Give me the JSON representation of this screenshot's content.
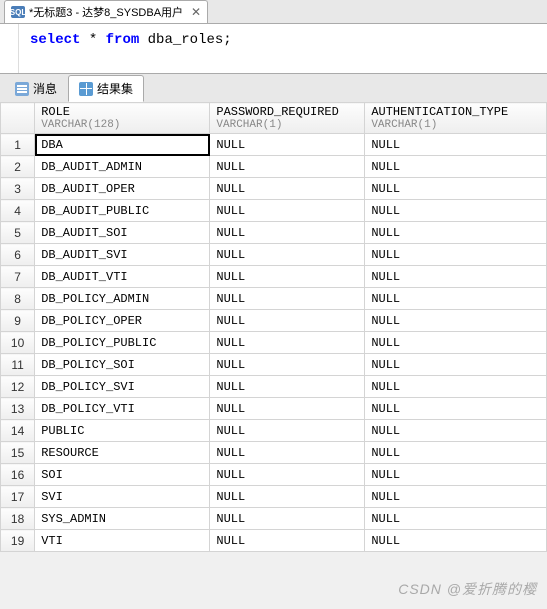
{
  "editor": {
    "tab_icon": "SQL",
    "tab_title": "*无标题3 - 达梦8_SYSDBA用户",
    "sql": {
      "select": "select",
      "star": "*",
      "from": "from",
      "table": "dba_roles",
      "semicolon": ";"
    }
  },
  "result_tabs": {
    "messages": "消息",
    "results": "结果集"
  },
  "grid": {
    "columns": [
      {
        "name": "ROLE",
        "type": "VARCHAR(128)"
      },
      {
        "name": "PASSWORD_REQUIRED",
        "type": "VARCHAR(1)"
      },
      {
        "name": "AUTHENTICATION_TYPE",
        "type": "VARCHAR(1)"
      }
    ],
    "rows": [
      {
        "n": "1",
        "role": "DBA",
        "pwd": "NULL",
        "auth": "NULL"
      },
      {
        "n": "2",
        "role": "DB_AUDIT_ADMIN",
        "pwd": "NULL",
        "auth": "NULL"
      },
      {
        "n": "3",
        "role": "DB_AUDIT_OPER",
        "pwd": "NULL",
        "auth": "NULL"
      },
      {
        "n": "4",
        "role": "DB_AUDIT_PUBLIC",
        "pwd": "NULL",
        "auth": "NULL"
      },
      {
        "n": "5",
        "role": "DB_AUDIT_SOI",
        "pwd": "NULL",
        "auth": "NULL"
      },
      {
        "n": "6",
        "role": "DB_AUDIT_SVI",
        "pwd": "NULL",
        "auth": "NULL"
      },
      {
        "n": "7",
        "role": "DB_AUDIT_VTI",
        "pwd": "NULL",
        "auth": "NULL"
      },
      {
        "n": "8",
        "role": "DB_POLICY_ADMIN",
        "pwd": "NULL",
        "auth": "NULL"
      },
      {
        "n": "9",
        "role": "DB_POLICY_OPER",
        "pwd": "NULL",
        "auth": "NULL"
      },
      {
        "n": "10",
        "role": "DB_POLICY_PUBLIC",
        "pwd": "NULL",
        "auth": "NULL"
      },
      {
        "n": "11",
        "role": "DB_POLICY_SOI",
        "pwd": "NULL",
        "auth": "NULL"
      },
      {
        "n": "12",
        "role": "DB_POLICY_SVI",
        "pwd": "NULL",
        "auth": "NULL"
      },
      {
        "n": "13",
        "role": "DB_POLICY_VTI",
        "pwd": "NULL",
        "auth": "NULL"
      },
      {
        "n": "14",
        "role": "PUBLIC",
        "pwd": "NULL",
        "auth": "NULL"
      },
      {
        "n": "15",
        "role": "RESOURCE",
        "pwd": "NULL",
        "auth": "NULL"
      },
      {
        "n": "16",
        "role": "SOI",
        "pwd": "NULL",
        "auth": "NULL"
      },
      {
        "n": "17",
        "role": "SVI",
        "pwd": "NULL",
        "auth": "NULL"
      },
      {
        "n": "18",
        "role": "SYS_ADMIN",
        "pwd": "NULL",
        "auth": "NULL"
      },
      {
        "n": "19",
        "role": "VTI",
        "pwd": "NULL",
        "auth": "NULL"
      }
    ]
  },
  "watermark": "CSDN @爱折腾的樱"
}
